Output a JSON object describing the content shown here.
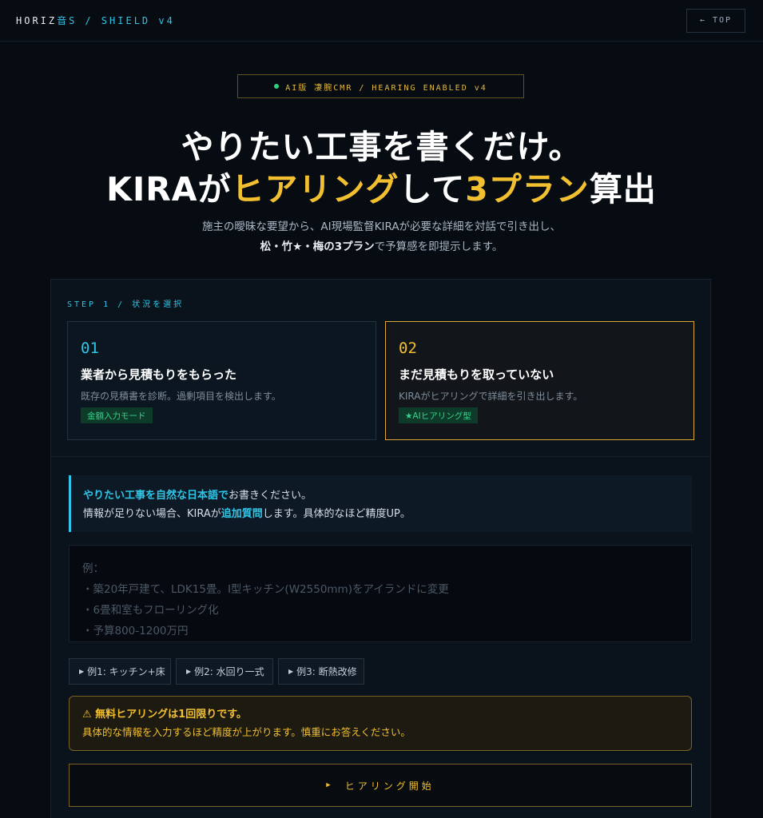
{
  "header": {
    "brand_a": "HORIZ",
    "brand_b": "音S",
    "brand_c": "/ SHIELD v4",
    "top_button": "← TOP"
  },
  "hero": {
    "badge": "AI版 凄腕CMR / HEARING ENABLED v4",
    "title_line1": "やりたい工事を書くだけ。",
    "title_line2_a": "KIRAが",
    "title_line2_b": "ヒアリング",
    "title_line2_c": "して",
    "title_line2_d": "3プラン",
    "title_line2_e": "算出",
    "sub_line1": "施主の曖昧な要望から、AI現場監督KIRAが必要な詳細を対話で引き出し、",
    "sub_line2_strong": "松・竹★・梅の3プラン",
    "sub_line2_rest": "で予算感を即提示します。"
  },
  "step": {
    "label": "STEP 1 / 状況を選択",
    "cards": [
      {
        "num": "01",
        "title": "業者から見積もりをもらった",
        "desc": "既存の見積書を診断。過剰項目を検出します。",
        "tag": "金額入力モード"
      },
      {
        "num": "02",
        "title": "まだ見積もりを取っていない",
        "desc": "KIRAがヒアリングで詳細を引き出します。",
        "tag": "★AIヒアリング型"
      }
    ]
  },
  "info": {
    "r1_key": "やりたい工事を自然な日本語で",
    "r1_rest": "お書きください。",
    "r2_a": "情報が足りない場合、KIRAが",
    "r2_key": "追加質問",
    "r2_b": "します。具体的なほど精度UP。"
  },
  "textarea": {
    "placeholder_lines": [
      "例：",
      "・築20年戸建て、LDK15畳。I型キッチン(W2550mm)をアイランドに変更",
      "・6畳和室もフローリング化",
      "・予算800-1200万円"
    ]
  },
  "examples": [
    "例1: キッチン+床",
    "例2: 水回り一式",
    "例3: 断熱改修"
  ],
  "warning": {
    "line1": "⚠ 無料ヒアリングは1回限りです。",
    "line2": "具体的な情報を入力するほど精度が上がります。慎重にお答えください。"
  },
  "start_button": "ヒアリング開始",
  "colors": {
    "accent_cyan": "#2ec5e6",
    "accent_gold": "#f2bf30",
    "tag_green": "#35d489",
    "background": "#070c13"
  }
}
